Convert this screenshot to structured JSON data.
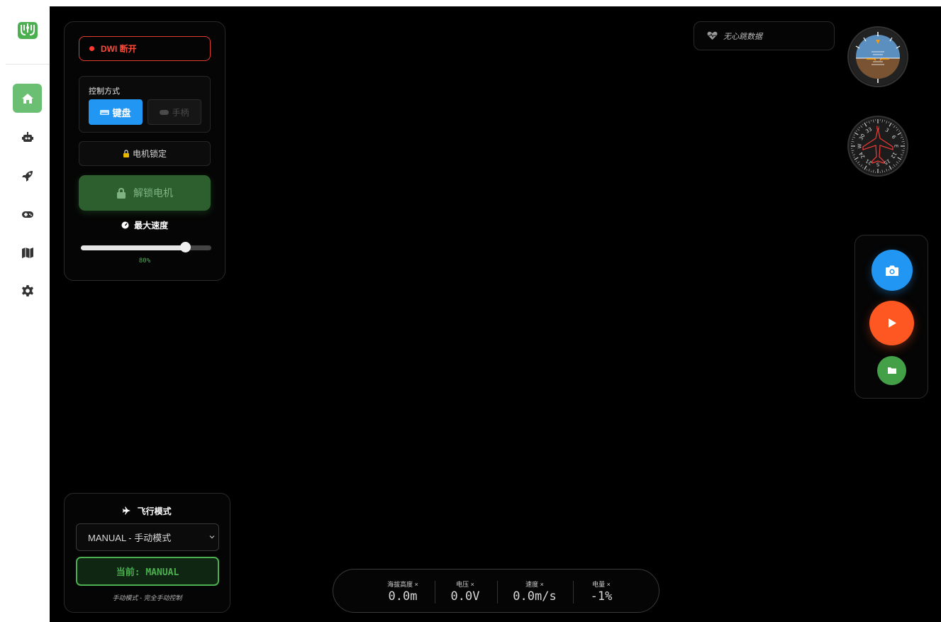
{
  "connection": {
    "status_label": "DWI 断开",
    "status_color": "#ff3b30"
  },
  "control": {
    "title": "控制方式",
    "keyboard_label": "键盘",
    "gamepad_label": "手柄",
    "selected": "keyboard",
    "accent": "#2196f3"
  },
  "motor": {
    "lock_status": "电机锁定",
    "unlock_label": "解锁电机"
  },
  "max_speed": {
    "title": "最大速度",
    "value_percent": 80,
    "value_label": "80%"
  },
  "flight_mode": {
    "title": "飞行模式",
    "selected_option": "MANUAL - 手动模式",
    "current_label": "当前: MANUAL",
    "description": "手动模式 - 完全手动控制"
  },
  "heartbeat": {
    "label": "无心跳数据"
  },
  "attitude_indicator": {
    "icon": "attitude-indicator-icon"
  },
  "heading_indicator": {
    "icon": "compass-icon",
    "labels": [
      "N",
      "3",
      "6",
      "E",
      "12",
      "15",
      "S",
      "21",
      "24",
      "W",
      "30",
      "33"
    ]
  },
  "media": {
    "camera": {
      "icon": "camera-icon",
      "color": "#2196f3"
    },
    "record": {
      "icon": "play-icon",
      "color": "#ff5722"
    },
    "files": {
      "icon": "folder-icon",
      "color": "#43a047"
    }
  },
  "telemetry": [
    {
      "label": "海拔高度 ×",
      "value": "0.0m"
    },
    {
      "label": "电压 ×",
      "value": "0.0V"
    },
    {
      "label": "速度 ×",
      "value": "0.0m/s"
    },
    {
      "label": "电量 ×",
      "value": "-1%"
    }
  ],
  "sidebar": {
    "logo": "circuit-logo-icon",
    "items": [
      {
        "name": "home",
        "icon": "home-icon",
        "active": true
      },
      {
        "name": "robot",
        "icon": "robot-icon",
        "active": false
      },
      {
        "name": "rocket",
        "icon": "rocket-icon",
        "active": false
      },
      {
        "name": "gamepad",
        "icon": "gamepad-icon",
        "active": false
      },
      {
        "name": "map",
        "icon": "map-icon",
        "active": false
      },
      {
        "name": "settings",
        "icon": "gear-icon",
        "active": false
      }
    ]
  }
}
